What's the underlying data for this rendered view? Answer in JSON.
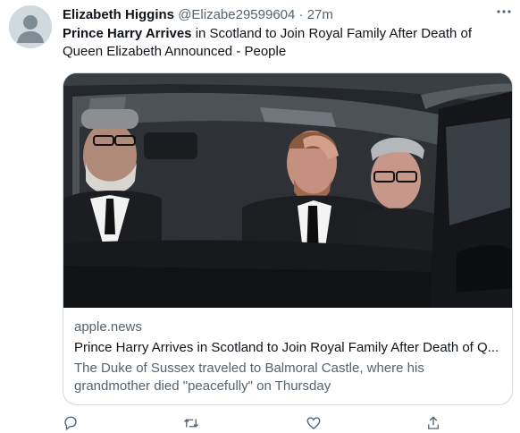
{
  "tweet": {
    "author_name": "Elizabeth Higgins",
    "author_handle": "@Elizabe29599604",
    "separator": "·",
    "time": "27m",
    "text_bold": "Prince Harry Arrives",
    "text_rest": " in Scotland to Join Royal Family After Death of Queen Elizabeth Announced - People"
  },
  "card": {
    "domain": "apple.news",
    "title": "Prince Harry Arrives in Scotland to Join Royal Family After Death of Q...",
    "description": "The Duke of Sussex traveled to Balmoral Castle, where his grandmother died \"peacefully\" on Thursday"
  },
  "icons": {
    "more": "more-horizontal-icon",
    "reply": "reply-icon",
    "retweet": "retweet-icon",
    "like": "like-icon",
    "share": "share-icon"
  },
  "colors": {
    "text_primary": "#0f1419",
    "text_secondary": "#536471",
    "border": "#cfd9de"
  }
}
